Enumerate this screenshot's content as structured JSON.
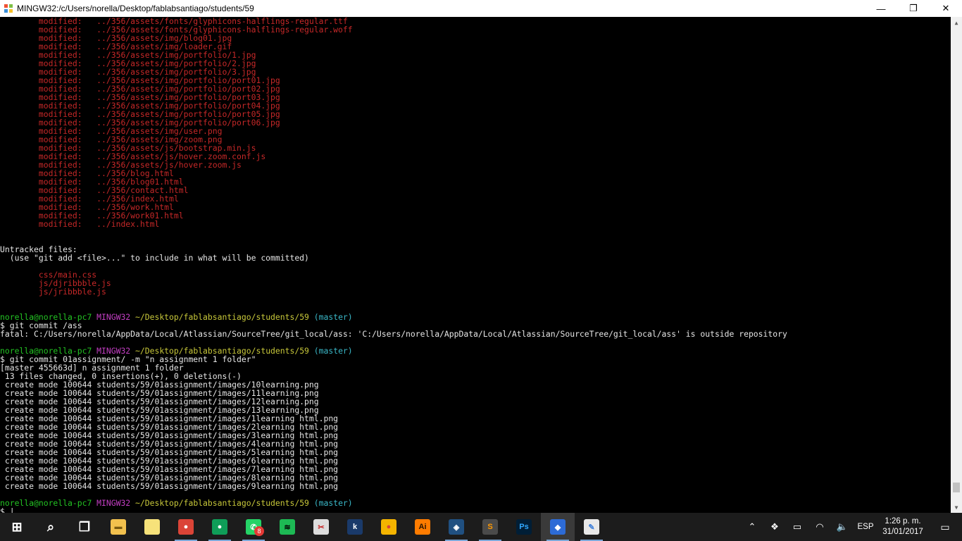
{
  "window": {
    "title": "MINGW32:/c/Users/norella/Desktop/fablabsantiago/students/59",
    "minimize": "—",
    "maximize": "❐",
    "close": "✕"
  },
  "terminal": {
    "lines": [
      {
        "segments": [
          {
            "t": "        modified:   ../356/assets/fonts/glyphicons-halflings-regular.ttf",
            "c": "red"
          }
        ]
      },
      {
        "segments": [
          {
            "t": "        modified:   ../356/assets/fonts/glyphicons-halflings-regular.woff",
            "c": "red"
          }
        ]
      },
      {
        "segments": [
          {
            "t": "        modified:   ../356/assets/img/blog01.jpg",
            "c": "red"
          }
        ]
      },
      {
        "segments": [
          {
            "t": "        modified:   ../356/assets/img/loader.gif",
            "c": "red"
          }
        ]
      },
      {
        "segments": [
          {
            "t": "        modified:   ../356/assets/img/portfolio/1.jpg",
            "c": "red"
          }
        ]
      },
      {
        "segments": [
          {
            "t": "        modified:   ../356/assets/img/portfolio/2.jpg",
            "c": "red"
          }
        ]
      },
      {
        "segments": [
          {
            "t": "        modified:   ../356/assets/img/portfolio/3.jpg",
            "c": "red"
          }
        ]
      },
      {
        "segments": [
          {
            "t": "        modified:   ../356/assets/img/portfolio/port01.jpg",
            "c": "red"
          }
        ]
      },
      {
        "segments": [
          {
            "t": "        modified:   ../356/assets/img/portfolio/port02.jpg",
            "c": "red"
          }
        ]
      },
      {
        "segments": [
          {
            "t": "        modified:   ../356/assets/img/portfolio/port03.jpg",
            "c": "red"
          }
        ]
      },
      {
        "segments": [
          {
            "t": "        modified:   ../356/assets/img/portfolio/port04.jpg",
            "c": "red"
          }
        ]
      },
      {
        "segments": [
          {
            "t": "        modified:   ../356/assets/img/portfolio/port05.jpg",
            "c": "red"
          }
        ]
      },
      {
        "segments": [
          {
            "t": "        modified:   ../356/assets/img/portfolio/port06.jpg",
            "c": "red"
          }
        ]
      },
      {
        "segments": [
          {
            "t": "        modified:   ../356/assets/img/user.png",
            "c": "red"
          }
        ]
      },
      {
        "segments": [
          {
            "t": "        modified:   ../356/assets/img/zoom.png",
            "c": "red"
          }
        ]
      },
      {
        "segments": [
          {
            "t": "        modified:   ../356/assets/js/bootstrap.min.js",
            "c": "red"
          }
        ]
      },
      {
        "segments": [
          {
            "t": "        modified:   ../356/assets/js/hover.zoom.conf.js",
            "c": "red"
          }
        ]
      },
      {
        "segments": [
          {
            "t": "        modified:   ../356/assets/js/hover.zoom.js",
            "c": "red"
          }
        ]
      },
      {
        "segments": [
          {
            "t": "        modified:   ../356/blog.html",
            "c": "red"
          }
        ]
      },
      {
        "segments": [
          {
            "t": "        modified:   ../356/blog01.html",
            "c": "red"
          }
        ]
      },
      {
        "segments": [
          {
            "t": "        modified:   ../356/contact.html",
            "c": "red"
          }
        ]
      },
      {
        "segments": [
          {
            "t": "        modified:   ../356/index.html",
            "c": "red"
          }
        ]
      },
      {
        "segments": [
          {
            "t": "        modified:   ../356/work.html",
            "c": "red"
          }
        ]
      },
      {
        "segments": [
          {
            "t": "        modified:   ../356/work01.html",
            "c": "red"
          }
        ]
      },
      {
        "segments": [
          {
            "t": "        modified:   ../index.html",
            "c": "red"
          }
        ]
      },
      {
        "segments": []
      },
      {
        "segments": []
      },
      {
        "segments": [
          {
            "t": "Untracked files:",
            "c": "white"
          }
        ]
      },
      {
        "segments": [
          {
            "t": "  (use \"git add <file>...\" to include in what will be committed)",
            "c": "white"
          }
        ]
      },
      {
        "segments": []
      },
      {
        "segments": [
          {
            "t": "        css/main.css",
            "c": "red"
          }
        ]
      },
      {
        "segments": [
          {
            "t": "        js/djribbble.js",
            "c": "red"
          }
        ]
      },
      {
        "segments": [
          {
            "t": "        js/jribbble.js",
            "c": "red"
          }
        ]
      },
      {
        "segments": []
      },
      {
        "segments": []
      },
      {
        "segments": [
          {
            "t": "norella@norella-pc7 ",
            "c": "green"
          },
          {
            "t": "MINGW32 ",
            "c": "magenta"
          },
          {
            "t": "~/Desktop/fablabsantiago/students/59",
            "c": "yellow"
          },
          {
            "t": " (master)",
            "c": "cyan"
          }
        ]
      },
      {
        "segments": [
          {
            "t": "$ git commit /ass",
            "c": "white"
          }
        ]
      },
      {
        "segments": [
          {
            "t": "fatal: C:/Users/norella/AppData/Local/Atlassian/SourceTree/git_local/ass: 'C:/Users/norella/AppData/Local/Atlassian/SourceTree/git_local/ass' is outside repository",
            "c": "white"
          }
        ]
      },
      {
        "segments": []
      },
      {
        "segments": [
          {
            "t": "norella@norella-pc7 ",
            "c": "green"
          },
          {
            "t": "MINGW32 ",
            "c": "magenta"
          },
          {
            "t": "~/Desktop/fablabsantiago/students/59",
            "c": "yellow"
          },
          {
            "t": " (master)",
            "c": "cyan"
          }
        ]
      },
      {
        "segments": [
          {
            "t": "$ git commit 01assignment/ -m \"n assignment 1 folder\"",
            "c": "white"
          }
        ]
      },
      {
        "segments": [
          {
            "t": "[master 455663d] n assignment 1 folder",
            "c": "white"
          }
        ]
      },
      {
        "segments": [
          {
            "t": " 13 files changed, 0 insertions(+), 0 deletions(-)",
            "c": "white"
          }
        ]
      },
      {
        "segments": [
          {
            "t": " create mode 100644 students/59/01assignment/images/10learning.png",
            "c": "white"
          }
        ]
      },
      {
        "segments": [
          {
            "t": " create mode 100644 students/59/01assignment/images/11learning.png",
            "c": "white"
          }
        ]
      },
      {
        "segments": [
          {
            "t": " create mode 100644 students/59/01assignment/images/12learning.png",
            "c": "white"
          }
        ]
      },
      {
        "segments": [
          {
            "t": " create mode 100644 students/59/01assignment/images/13learning.png",
            "c": "white"
          }
        ]
      },
      {
        "segments": [
          {
            "t": " create mode 100644 students/59/01assignment/images/1learning html.png",
            "c": "white"
          }
        ]
      },
      {
        "segments": [
          {
            "t": " create mode 100644 students/59/01assignment/images/2learning html.png",
            "c": "white"
          }
        ]
      },
      {
        "segments": [
          {
            "t": " create mode 100644 students/59/01assignment/images/3learning html.png",
            "c": "white"
          }
        ]
      },
      {
        "segments": [
          {
            "t": " create mode 100644 students/59/01assignment/images/4learning html.png",
            "c": "white"
          }
        ]
      },
      {
        "segments": [
          {
            "t": " create mode 100644 students/59/01assignment/images/5learning html.png",
            "c": "white"
          }
        ]
      },
      {
        "segments": [
          {
            "t": " create mode 100644 students/59/01assignment/images/6learning html.png",
            "c": "white"
          }
        ]
      },
      {
        "segments": [
          {
            "t": " create mode 100644 students/59/01assignment/images/7learning html.png",
            "c": "white"
          }
        ]
      },
      {
        "segments": [
          {
            "t": " create mode 100644 students/59/01assignment/images/8learning html.png",
            "c": "white"
          }
        ]
      },
      {
        "segments": [
          {
            "t": " create mode 100644 students/59/01assignment/images/9learning html.png",
            "c": "white"
          }
        ]
      },
      {
        "segments": []
      },
      {
        "segments": [
          {
            "t": "norella@norella-pc7 ",
            "c": "green"
          },
          {
            "t": "MINGW32 ",
            "c": "magenta"
          },
          {
            "t": "~/Desktop/fablabsantiago/students/59",
            "c": "yellow"
          },
          {
            "t": " (master)",
            "c": "cyan"
          }
        ]
      },
      {
        "segments": [
          {
            "t": "$ |",
            "c": "white"
          }
        ]
      }
    ]
  },
  "scrollbar": {
    "position": 0.98
  },
  "taskbar": {
    "apps": [
      {
        "name": "start-button",
        "icon": "windows-logo-icon",
        "glyph": "⊞",
        "bg": "transparent",
        "fg": "#ffffff"
      },
      {
        "name": "search-button",
        "icon": "search-icon",
        "glyph": "⌕",
        "bg": "transparent",
        "fg": "#ffffff"
      },
      {
        "name": "task-view-button",
        "icon": "task-view-icon",
        "glyph": "❐",
        "bg": "transparent",
        "fg": "#ffffff"
      },
      {
        "name": "file-explorer-button",
        "icon": "folder-icon",
        "glyph": "▬",
        "bg": "#f2c14e",
        "fg": "#7a5a10"
      },
      {
        "name": "sticky-notes-button",
        "icon": "sticky-note-icon",
        "glyph": "",
        "bg": "#f7e27a",
        "fg": "#000000"
      },
      {
        "name": "chrome-user-button",
        "icon": "chrome-icon",
        "glyph": "●",
        "bg": "#db4437",
        "fg": "#ffffff"
      },
      {
        "name": "chrome-profile-button",
        "icon": "chrome-icon",
        "glyph": "●",
        "bg": "#0f9d58",
        "fg": "#ffffff"
      },
      {
        "name": "whatsapp-button",
        "icon": "whatsapp-icon",
        "glyph": "✆",
        "bg": "#25d366",
        "fg": "#ffffff"
      },
      {
        "name": "spotify-button",
        "icon": "spotify-icon",
        "glyph": "≋",
        "bg": "#1db954",
        "fg": "#000000"
      },
      {
        "name": "snipping-tool-button",
        "icon": "scissors-icon",
        "glyph": "✂",
        "bg": "#dddddd",
        "fg": "#c62828"
      },
      {
        "name": "kindle-button",
        "icon": "kindle-icon",
        "glyph": "k",
        "bg": "#1a3a6a",
        "fg": "#ffffff"
      },
      {
        "name": "chrome-button",
        "icon": "chrome-icon",
        "glyph": "●",
        "bg": "#f4b400",
        "fg": "#db4437"
      },
      {
        "name": "illustrator-button",
        "icon": "illustrator-icon",
        "glyph": "Ai",
        "bg": "#ff7c00",
        "fg": "#2a1400"
      },
      {
        "name": "sourcetree-button",
        "icon": "sourcetree-icon",
        "glyph": "◈",
        "bg": "#205081",
        "fg": "#ffffff"
      },
      {
        "name": "sublime-text-button",
        "icon": "sublime-text-icon",
        "glyph": "S",
        "bg": "#4a4a4a",
        "fg": "#ff9800"
      },
      {
        "name": "photoshop-button",
        "icon": "photoshop-icon",
        "glyph": "Ps",
        "bg": "#001e36",
        "fg": "#31a8ff"
      },
      {
        "name": "git-bash-button",
        "icon": "git-icon",
        "glyph": "◆",
        "bg": "#2d6bd6",
        "fg": "#ffffff"
      },
      {
        "name": "paint-button",
        "icon": "paint-palette-icon",
        "glyph": "✎",
        "bg": "#e8e8e8",
        "fg": "#3f7fd8"
      }
    ],
    "whatsapp_badge": "8",
    "tray": {
      "chevron": "⌃",
      "dropbox": "❖",
      "battery": "▭",
      "wifi": "◠",
      "volume": "🔈",
      "language": "ESP",
      "time": "1:26 p. m.",
      "date": "31/01/2017",
      "notifications": "▭"
    }
  }
}
